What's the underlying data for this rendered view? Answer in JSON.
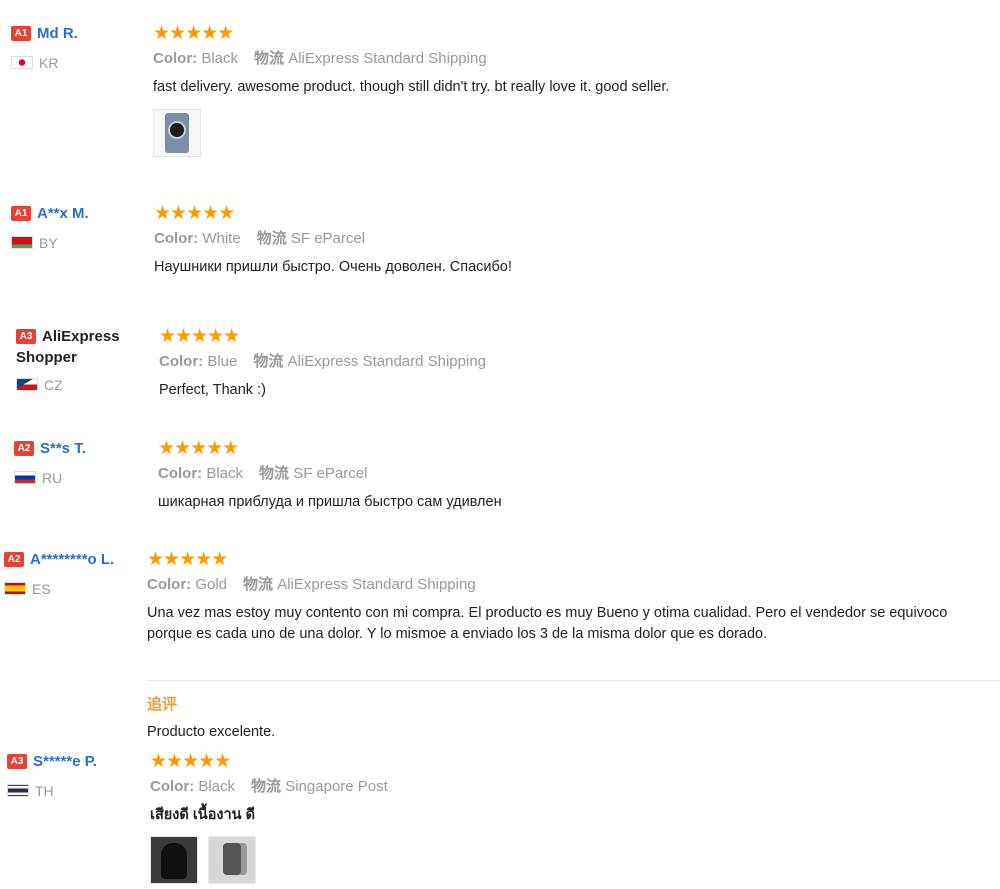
{
  "reviews": [
    {
      "badge": "A1",
      "name": "Md R.",
      "country": "KR",
      "meta_color_label": "Color:",
      "meta_color": "Black",
      "meta_ship_label": "物流",
      "meta_ship": "AliExpress Standard Shipping",
      "text": "fast delivery. awesome product. though still didn't try. bt really love it. good seller."
    },
    {
      "badge": "A1",
      "name": "A**x M.",
      "country": "BY",
      "meta_color_label": "Color:",
      "meta_color": "White",
      "meta_ship_label": "物流",
      "meta_ship": "SF eParcel",
      "text": "Наушники пришли быстро. Очень доволен. Спасибо!"
    },
    {
      "badge": "A3",
      "name_line1": "AliExpress",
      "name_line2": "Shopper",
      "country": "CZ",
      "meta_color_label": "Color:",
      "meta_color": "Blue",
      "meta_ship_label": "物流",
      "meta_ship": "AliExpress Standard Shipping",
      "text": "Perfect, Thank :)"
    },
    {
      "badge": "A2",
      "name": "S**s T.",
      "country": "RU",
      "meta_color_label": "Color:",
      "meta_color": "Black",
      "meta_ship_label": "物流",
      "meta_ship": "SF eParcel",
      "text": "шикарная приблуда и пришла быстро сам удивлен"
    },
    {
      "badge": "A2",
      "name": "A********o L.",
      "country": "ES",
      "meta_color_label": "Color:",
      "meta_color": "Gold",
      "meta_ship_label": "物流",
      "meta_ship": "AliExpress Standard Shipping",
      "text_line1": "Una vez mas estoy muy contento con mi compra. El producto es muy Bueno y otima cualidad. Pero el vendedor se equivoco",
      "text_line2": "porque es cada uno de una dolor. Y lo mismoe a enviado los 3 de la misma dolor que es dorado.",
      "followup_label": "追评",
      "followup_text": "Producto excelente."
    },
    {
      "badge": "A3",
      "name": "S*****e P.",
      "country": "TH",
      "meta_color_label": "Color:",
      "meta_color": "Black",
      "meta_ship_label": "物流",
      "meta_ship": "Singapore Post",
      "text": "เสียงดี เนื้องาน ดี"
    }
  ],
  "stars": "★★★★★",
  "colors": {
    "star": "#ff9a00",
    "badge": "#e64133",
    "name_link": "#2d6ec7",
    "followup": "#f29b38"
  },
  "icons": [
    "review-photo-thumbnail"
  ]
}
